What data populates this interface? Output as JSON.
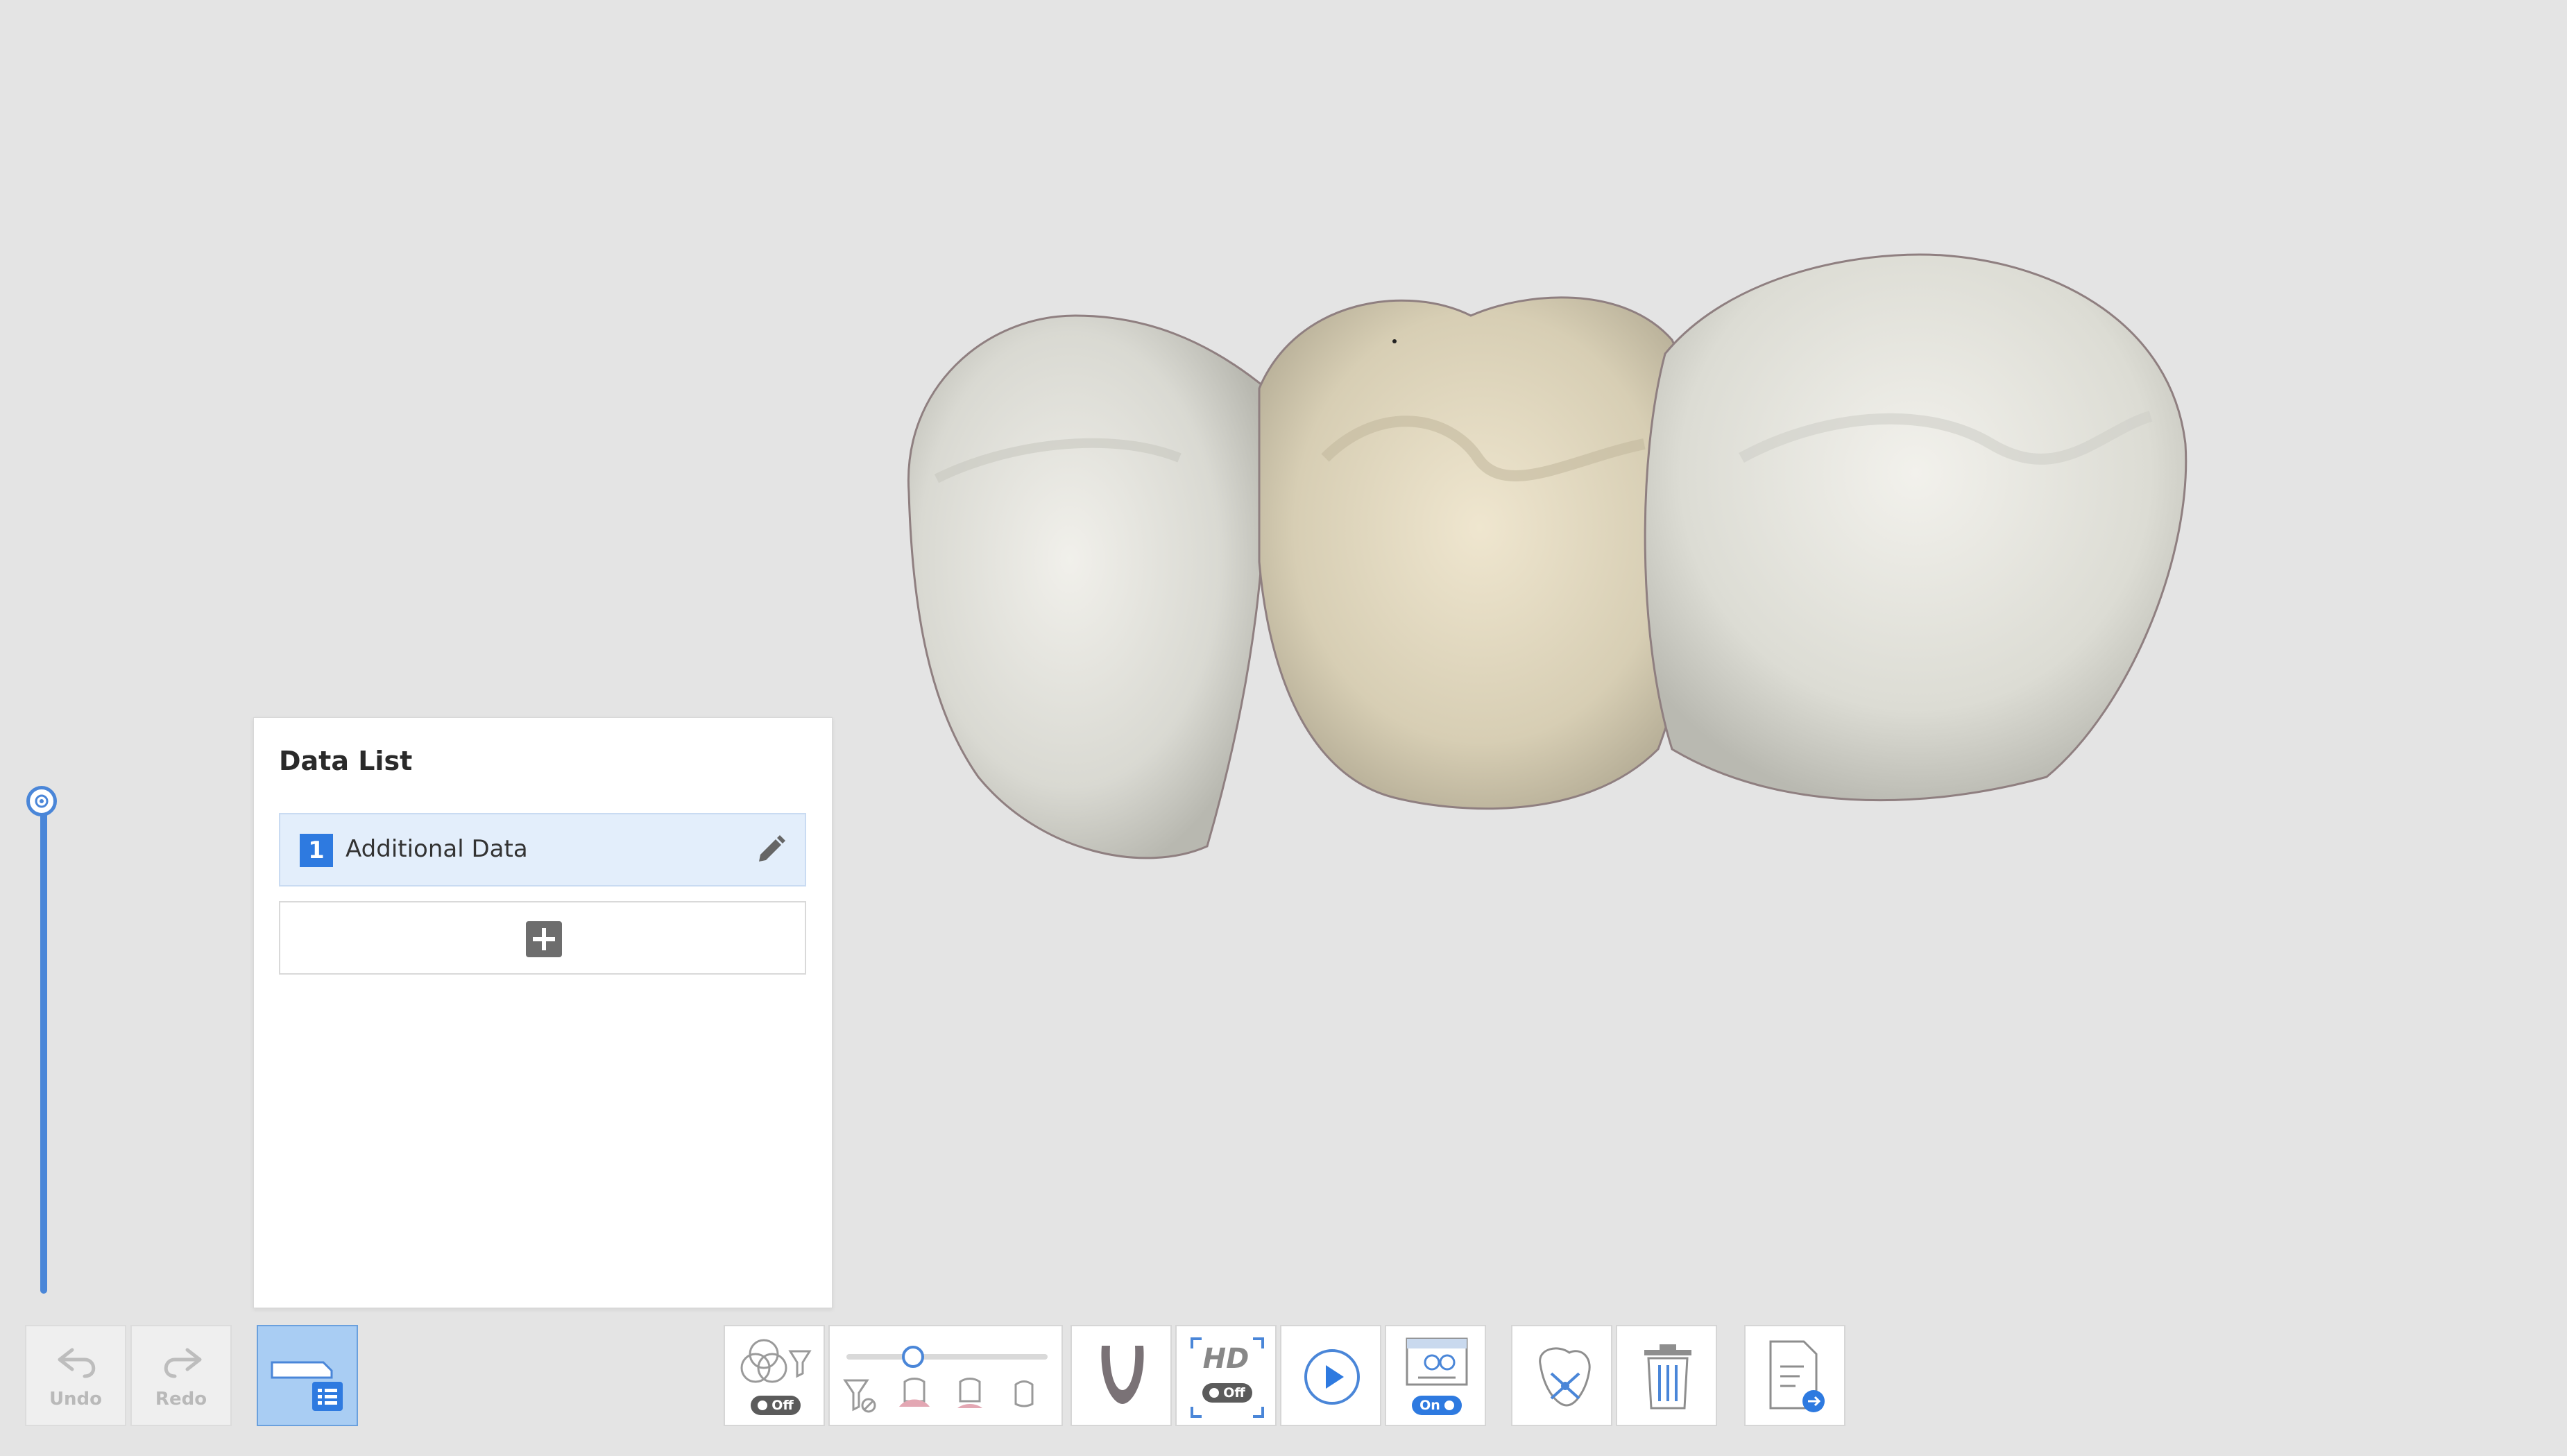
{
  "data_list": {
    "title": "Data List",
    "items": [
      {
        "index": "1",
        "label": "Additional Data"
      }
    ]
  },
  "toolbar": {
    "undo_label": "Undo",
    "redo_label": "Redo",
    "filter_toggle_state": "Off",
    "hd_label": "HD",
    "hd_toggle_state": "Off",
    "view_toggle_state": "On"
  },
  "viewer": {
    "model": "three-unit-tooth-scan"
  },
  "colors": {
    "accent": "#2e7ae0",
    "background": "#e4e4e4"
  }
}
